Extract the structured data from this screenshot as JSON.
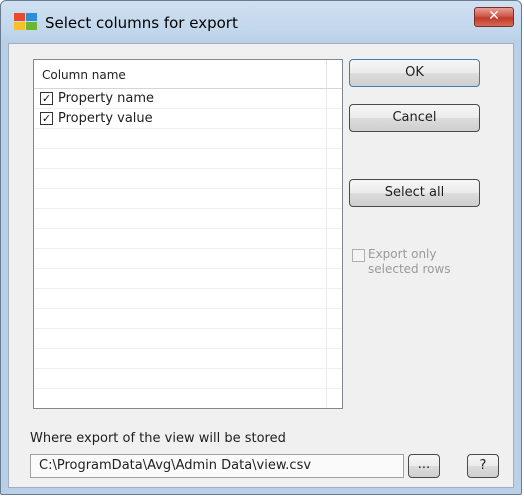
{
  "window": {
    "title": "Select columns for export",
    "close_glyph": "✕",
    "accent_close": "#c8463a"
  },
  "columns_list": {
    "header": "Column name",
    "items": [
      {
        "label": "Property name",
        "checked": true
      },
      {
        "label": "Property value",
        "checked": true
      }
    ],
    "empty_row_count": 14
  },
  "buttons": {
    "ok": "OK",
    "cancel": "Cancel",
    "select_all": "Select all",
    "browse": "...",
    "help": "?"
  },
  "export_only": {
    "label": "Export only selected rows",
    "checked": false,
    "enabled": false
  },
  "storage": {
    "label": "Where export of the view will be stored",
    "path": "C:\\ProgramData\\Avg\\Admin Data\\view.csv"
  },
  "icons": {
    "app": "avg-logo-icon",
    "check": "checkmark-icon"
  }
}
